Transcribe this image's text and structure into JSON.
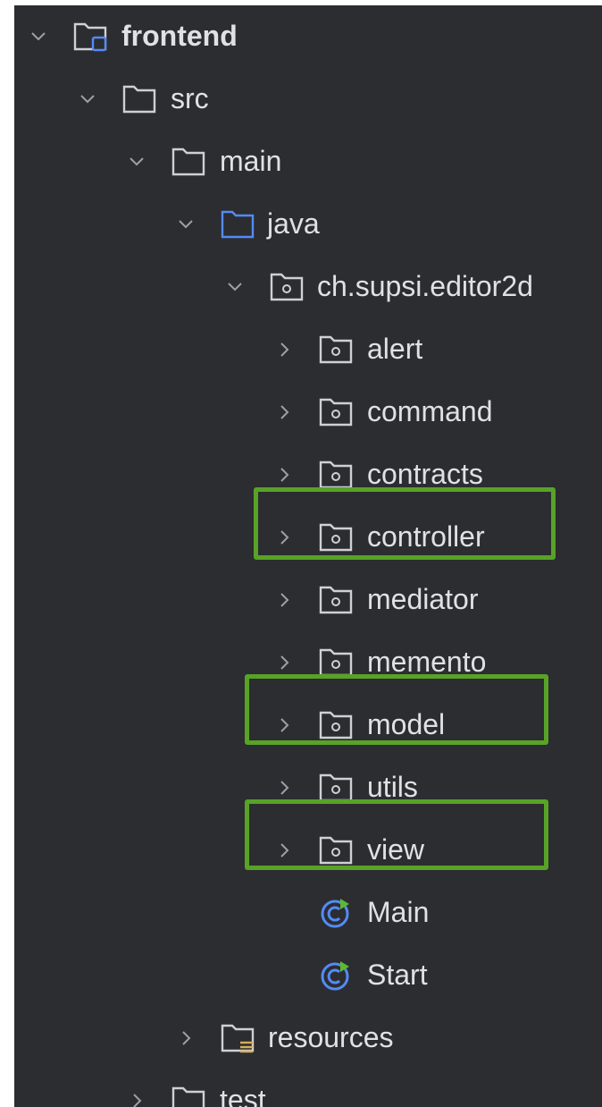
{
  "tree": {
    "items": [
      {
        "label": "frontend",
        "bold": true,
        "expanded": true,
        "chevron": "chevron-down-icon",
        "icon": "module-folder-icon"
      },
      {
        "label": "src",
        "expanded": true,
        "chevron": "chevron-down-icon",
        "icon": "folder-icon"
      },
      {
        "label": "main",
        "expanded": true,
        "chevron": "chevron-down-icon",
        "icon": "folder-icon"
      },
      {
        "label": "java",
        "expanded": true,
        "chevron": "chevron-down-icon",
        "icon": "source-folder-icon"
      },
      {
        "label": "ch.supsi.editor2d",
        "expanded": true,
        "chevron": "chevron-down-icon",
        "icon": "package-icon"
      },
      {
        "label": "alert",
        "expanded": false,
        "chevron": "chevron-right-icon",
        "icon": "package-icon"
      },
      {
        "label": "command",
        "expanded": false,
        "chevron": "chevron-right-icon",
        "icon": "package-icon"
      },
      {
        "label": "contracts",
        "expanded": false,
        "chevron": "chevron-right-icon",
        "icon": "package-icon"
      },
      {
        "label": "controller",
        "expanded": false,
        "chevron": "chevron-right-icon",
        "icon": "package-icon",
        "highlighted": true
      },
      {
        "label": "mediator",
        "expanded": false,
        "chevron": "chevron-right-icon",
        "icon": "package-icon"
      },
      {
        "label": "memento",
        "expanded": false,
        "chevron": "chevron-right-icon",
        "icon": "package-icon"
      },
      {
        "label": "model",
        "expanded": false,
        "chevron": "chevron-right-icon",
        "icon": "package-icon",
        "highlighted": true
      },
      {
        "label": "utils",
        "expanded": false,
        "chevron": "chevron-right-icon",
        "icon": "package-icon"
      },
      {
        "label": "view",
        "expanded": false,
        "chevron": "chevron-right-icon",
        "icon": "package-icon",
        "highlighted": true
      },
      {
        "label": "Main",
        "icon": "java-class-icon"
      },
      {
        "label": "Start",
        "icon": "java-class-icon"
      },
      {
        "label": "resources",
        "expanded": false,
        "chevron": "chevron-right-icon",
        "icon": "resources-folder-icon"
      },
      {
        "label": "test",
        "expanded": false,
        "chevron": "chevron-right-icon",
        "icon": "folder-icon"
      }
    ]
  },
  "colors": {
    "background": "#2b2d30",
    "text": "#dfe1e5",
    "highlight_border": "#58a327",
    "source_folder_accent": "#548af7",
    "resources_accent": "#d6ae58"
  }
}
